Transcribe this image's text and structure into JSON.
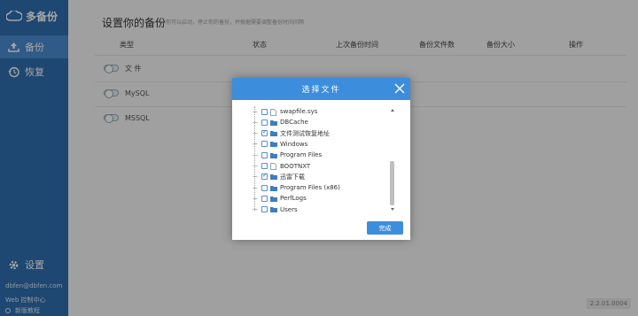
{
  "app": {
    "logo_text": "多备份"
  },
  "sidebar": {
    "items": [
      {
        "label": "备份",
        "icon": "upload-icon"
      },
      {
        "label": "恢复",
        "icon": "history-icon"
      }
    ],
    "settings_label": "设置",
    "email": "dbfen@dbfen.com",
    "web_link": "Web 控制中心",
    "new_link": "新版教程"
  },
  "main": {
    "title": "设置你的备份",
    "subtitle": "你可以启动，停止你的备份，并根据需要调整备份时间间隔",
    "headers": [
      "类型",
      "状态",
      "上次备份时间",
      "备份文件数",
      "备份大小",
      "操作"
    ],
    "rows": [
      {
        "label": "文  件"
      },
      {
        "label": "MySQL"
      },
      {
        "label": "MSSQL"
      }
    ],
    "version": "2.2.01.0004"
  },
  "dialog": {
    "title": "选择文件",
    "items": [
      {
        "label": "swapfile.sys",
        "checked": false,
        "type": "file"
      },
      {
        "label": "DBCache",
        "checked": false,
        "type": "folder"
      },
      {
        "label": "文件测试恢复地址",
        "checked": true,
        "type": "folder"
      },
      {
        "label": "Windows",
        "checked": false,
        "type": "folder"
      },
      {
        "label": "Program Files",
        "checked": false,
        "type": "folder"
      },
      {
        "label": "BOOTNXT",
        "checked": false,
        "type": "file"
      },
      {
        "label": "迅雷下载",
        "checked": true,
        "type": "folder"
      },
      {
        "label": "Program Files (x86)",
        "checked": false,
        "type": "folder"
      },
      {
        "label": "PerfLogs",
        "checked": false,
        "type": "folder"
      },
      {
        "label": "Users",
        "checked": false,
        "type": "folder"
      }
    ],
    "done_label": "完成"
  },
  "colors": {
    "sidebar": "#2f6eb0",
    "accent": "#3d8ddd"
  }
}
